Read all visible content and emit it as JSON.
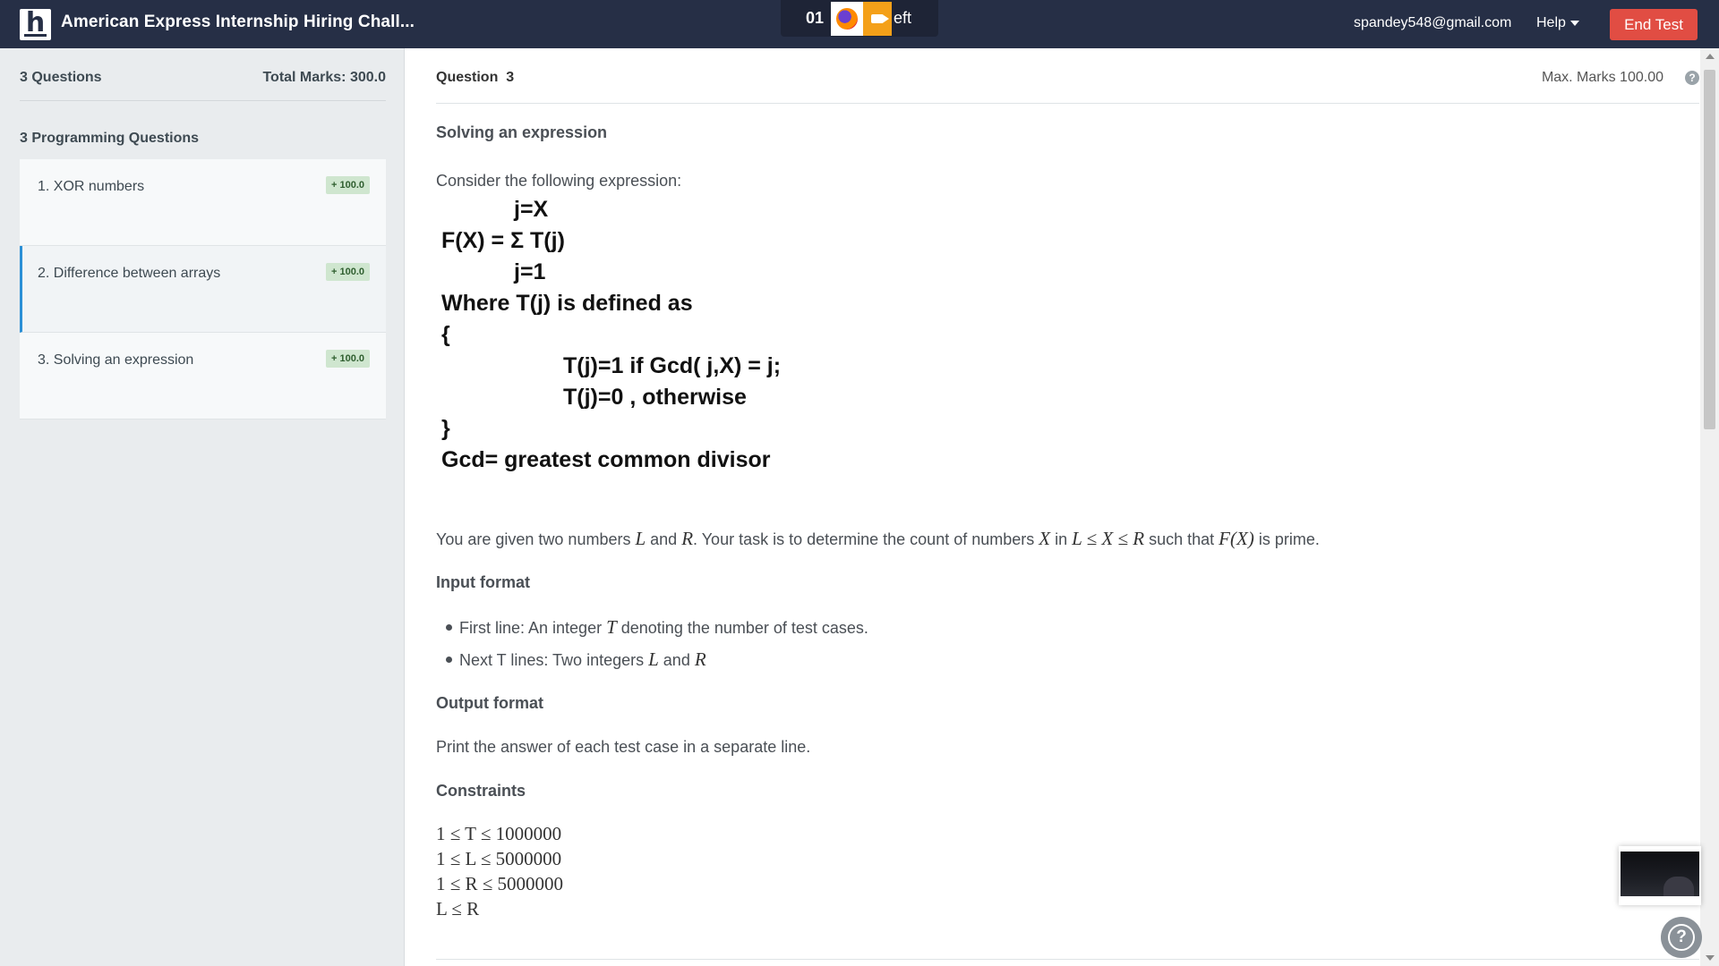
{
  "header": {
    "logo_letter": "h",
    "title": "American Express Internship Hiring Chall...",
    "timer_digits": "01",
    "timer_tail": "eft",
    "user_email": "spandey548@gmail.com",
    "help_label": "Help",
    "end_test_label": "End Test"
  },
  "sidebar": {
    "questions_count": "3 Questions",
    "total_marks": "Total Marks: 300.0",
    "section_title": "3 Programming Questions",
    "items": [
      {
        "label": "1. XOR numbers",
        "badge": "+ 100.0"
      },
      {
        "label": "2. Difference between arrays",
        "badge": "+ 100.0"
      },
      {
        "label": "3. Solving an expression",
        "badge": "+ 100.0"
      }
    ]
  },
  "question": {
    "label": "Question",
    "number": "3",
    "max_marks": "Max. Marks 100.00",
    "title": "Solving an expression",
    "intro": "Consider the following expression:",
    "expression": {
      "upper_limit": "j=X",
      "sum_line": "F(X) = Σ T(j)",
      "lower_limit": "j=1",
      "where_line": "Where T(j) is defined as",
      "open_brace": "{",
      "case1": "T(j)=1   if Gcd( j,X) = j;",
      "case2": "T(j)=0 , otherwise",
      "close_brace": "}",
      "gcd_note": "Gcd= greatest common divisor"
    },
    "given": {
      "part1": "You are given two numbers ",
      "L": "L",
      "part2": " and ",
      "R": "R",
      "part3": ". Your task is to determine the count of numbers ",
      "X": "X",
      "part4": " in ",
      "range": "L ≤ X ≤ R",
      "part5": " such that ",
      "fx": "F(X)",
      "part6": " is prime."
    },
    "input_format_title": "Input format",
    "input_bullets": [
      {
        "pre": "First line: An integer ",
        "var": "T",
        "post": " denoting the number of test cases."
      },
      {
        "pre": "Next T lines: Two integers ",
        "var": "L",
        "mid": " and ",
        "var2": "R"
      }
    ],
    "output_format_title": "Output format",
    "output_text": "Print the answer of each test case in a separate line.",
    "constraints_title": "Constraints",
    "constraints": [
      "1 ≤ T ≤ 1000000",
      "1 ≤ L ≤ 5000000",
      "1 ≤ R ≤ 5000000",
      "L ≤ R"
    ]
  },
  "icons": {
    "help_icon": "question-circle-icon",
    "firefox_icon": "firefox-icon",
    "camera_icon": "video-camera-icon",
    "support_icon": "support-question-icon"
  },
  "colors": {
    "header_bg": "#262f46",
    "end_test_bg": "#e14d43",
    "active_marker": "#2b8fd6",
    "badge_bg": "#cfe6cf"
  }
}
